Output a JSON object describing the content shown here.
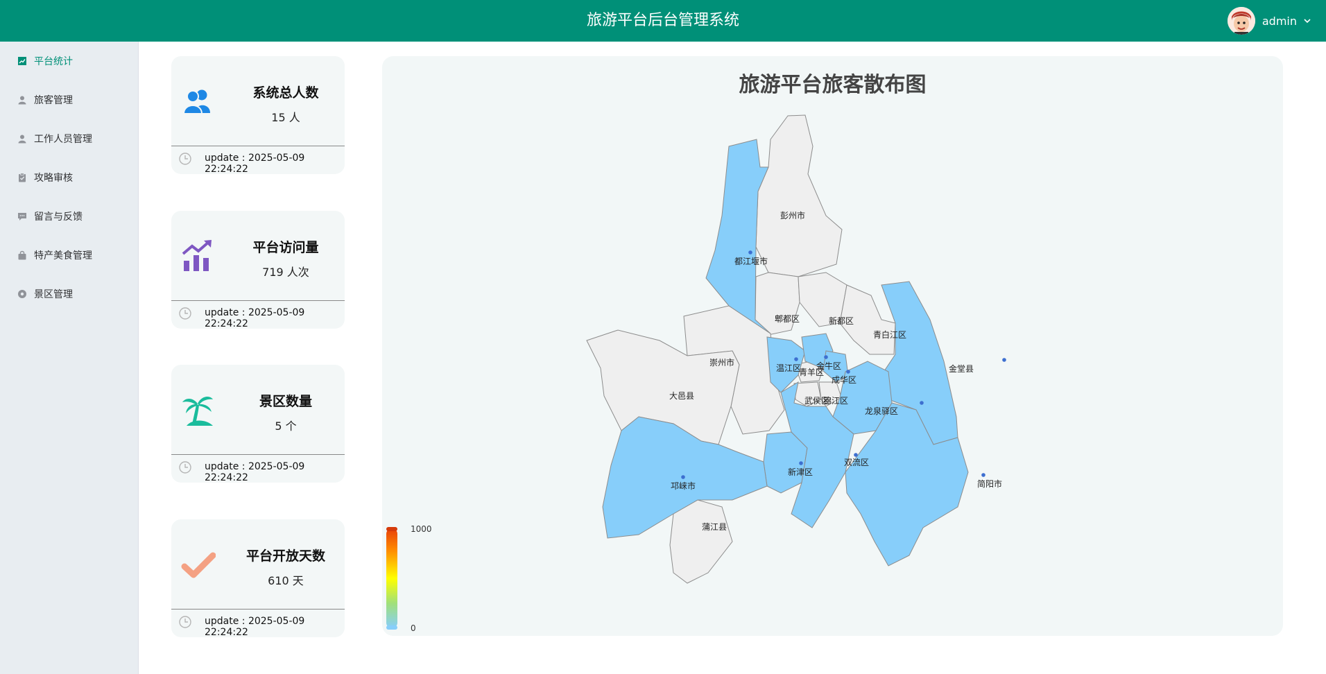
{
  "header": {
    "title": "旅游平台后台管理系统",
    "username": "admin"
  },
  "sidebar": {
    "items": [
      {
        "label": "平台统计",
        "icon": "chart-icon"
      },
      {
        "label": "旅客管理",
        "icon": "user-icon"
      },
      {
        "label": "工作人员管理",
        "icon": "user-icon"
      },
      {
        "label": "攻略审核",
        "icon": "clipboard-icon"
      },
      {
        "label": "留言与反馈",
        "icon": "message-icon"
      },
      {
        "label": "特产美食管理",
        "icon": "bag-icon"
      },
      {
        "label": "景区管理",
        "icon": "compass-icon"
      }
    ]
  },
  "cards": [
    {
      "title": "系统总人数",
      "value": "15 人",
      "update": "update : 2025-05-09 22:24:22",
      "icon": "users-icon",
      "color": "#1e88e5"
    },
    {
      "title": "平台访问量",
      "value": "719 人次",
      "update": "update : 2025-05-09 22:24:22",
      "icon": "trending-chart-icon",
      "color": "#7e57c2"
    },
    {
      "title": "景区数量",
      "value": "5 个",
      "update": "update : 2025-05-09 22:24:22",
      "icon": "palm-tree-icon",
      "color": "#1abc9c"
    },
    {
      "title": "平台开放天数",
      "value": "610 天",
      "update": "update : 2025-05-09 22:24:22",
      "icon": "check-icon",
      "color": "#f4a183"
    }
  ],
  "map": {
    "title": "旅游平台旅客散布图",
    "legend_max": "1000",
    "legend_min": "0",
    "highlight_color": "#87cefa",
    "base_color": "#efefef",
    "regions": [
      "彭州市",
      "都江堰市",
      "郫都区",
      "新都区",
      "青白江区",
      "崇州市",
      "温江区",
      "金牛区",
      "青羊区",
      "成华区",
      "金堂县",
      "大邑县",
      "武侯区",
      "锦江区",
      "龙泉驿区",
      "新津区",
      "双流区",
      "邛崃市",
      "简阳市",
      "蒲江县"
    ],
    "highlighted": [
      "都江堰市",
      "温江区",
      "金牛区",
      "成华区",
      "金堂县",
      "龙泉驿区",
      "新津区",
      "双流区",
      "邛崃市",
      "简阳市"
    ]
  }
}
